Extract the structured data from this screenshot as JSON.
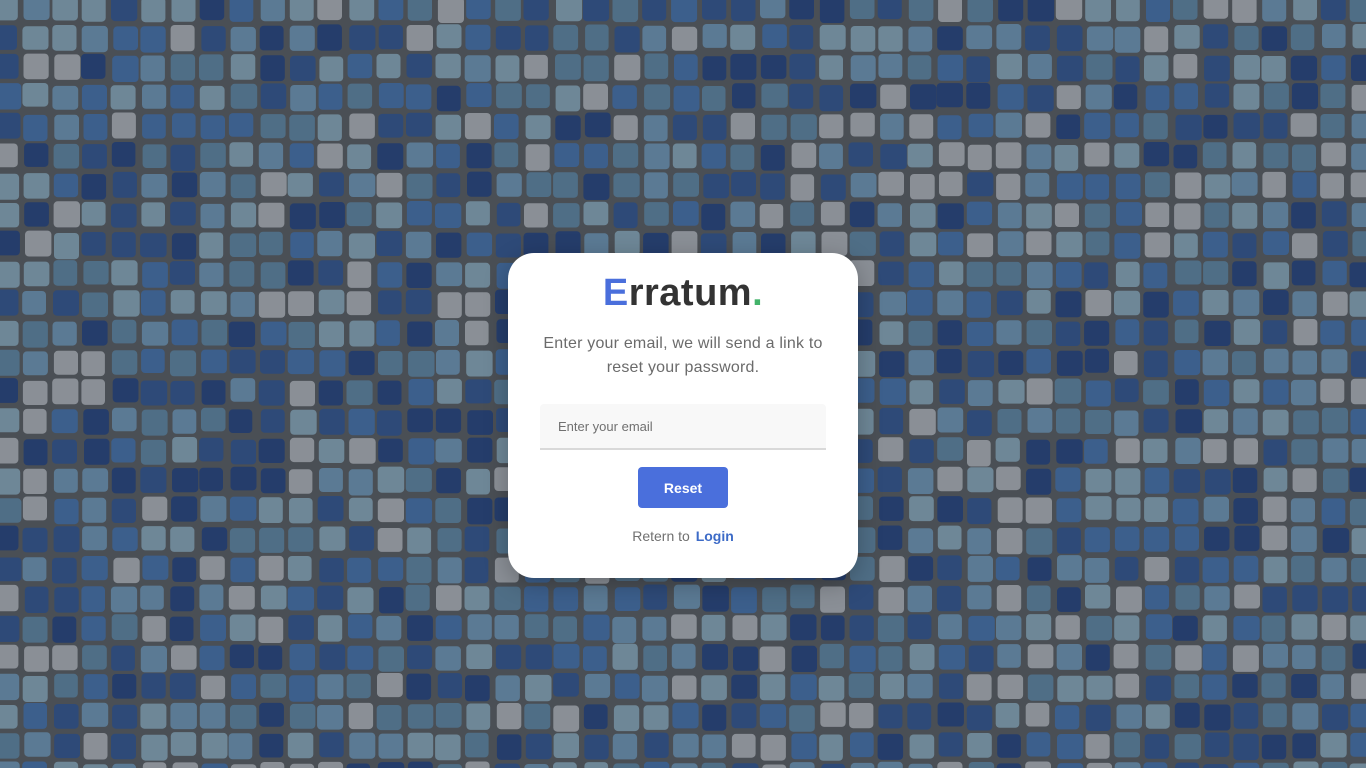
{
  "background": {
    "icon": "mosaic-tile-background",
    "colors": [
      "#2e4a78",
      "#3c5f8c",
      "#5b7a94",
      "#6e8797",
      "#8a8f96",
      "#253d6b",
      "#4f6e86"
    ],
    "grout_color": "#4a4f55"
  },
  "card": {
    "logo": {
      "first_letter": "E",
      "rest": "rratum",
      "dot": ".",
      "first_letter_color": "#4a6fdc",
      "dot_color": "#43b36a"
    },
    "subtitle": "Enter your email, we will send a link to reset your password.",
    "email": {
      "placeholder": "Enter your email",
      "value": ""
    },
    "reset_label": "Reset",
    "return_text": "Retern to",
    "login_label": "Login",
    "accent_color": "#4a6fdc"
  }
}
